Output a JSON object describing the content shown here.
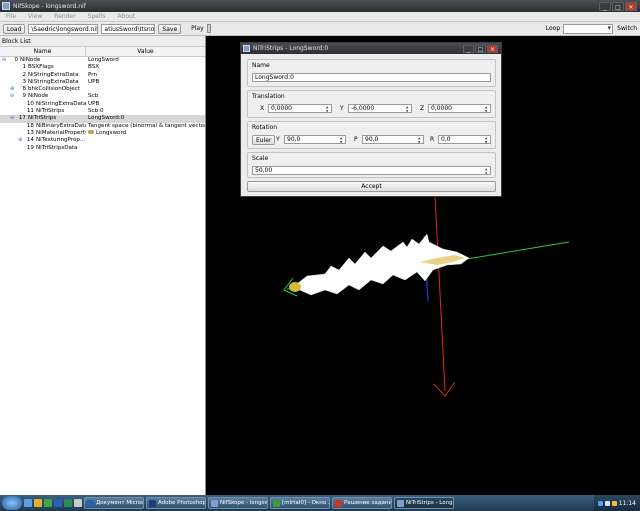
{
  "window": {
    "title": "NifSkope - longsword.nif"
  },
  "menu": [
    "File",
    "View",
    "Render",
    "Spells",
    "About"
  ],
  "toolbar": {
    "load_label": "Load",
    "load_path": "\\Saedric\\longsword.nif",
    "save_path": "atiusSword\\Itsnok.nif",
    "save_label": "Save",
    "play_label": "Play",
    "loop_label": "Loop",
    "switch_label": "Switch"
  },
  "blocklist": {
    "title": "Block List",
    "col_name": "Name",
    "col_value": "Value",
    "rows": [
      {
        "exp": "⊖",
        "num": "0",
        "name": "NiNode",
        "value": "LongSword",
        "indent": 0,
        "selected": false
      },
      {
        "exp": "",
        "num": "1",
        "name": "BSXFlags",
        "value": "BSX",
        "indent": 1,
        "selected": false
      },
      {
        "exp": "",
        "num": "2",
        "name": "NiStringExtraData",
        "value": "Prn",
        "indent": 1,
        "selected": false
      },
      {
        "exp": "",
        "num": "3",
        "name": "NiStringExtraData",
        "value": "UPB",
        "indent": 1,
        "selected": false
      },
      {
        "exp": "⊕",
        "num": "8",
        "name": "bhkCollisionObject",
        "value": "",
        "indent": 1,
        "selected": false
      },
      {
        "exp": "⊖",
        "num": "9",
        "name": "NiNode",
        "value": "Scb",
        "indent": 1,
        "selected": false
      },
      {
        "exp": "",
        "num": "10",
        "name": "NiStringExtraData",
        "value": "UPB",
        "indent": 2,
        "selected": false
      },
      {
        "exp": "",
        "num": "11",
        "name": "NiTriStrips",
        "value": "Scb:0",
        "indent": 2,
        "selected": false
      },
      {
        "exp": "⊖",
        "num": "17",
        "name": "NiTriStrips",
        "value": "LongSword:0",
        "indent": 1,
        "selected": true
      },
      {
        "exp": "",
        "num": "18",
        "name": "NiBinaryExtraData",
        "value": "Tangent space (binormal & tangent vectors)",
        "indent": 2,
        "selected": false
      },
      {
        "exp": "",
        "num": "13",
        "name": "NiMaterialProperty",
        "value": "Longsword",
        "indent": 2,
        "selected": false,
        "icon": true
      },
      {
        "exp": "⊕",
        "num": "14",
        "name": "NiTexturingProp...",
        "value": "",
        "indent": 2,
        "selected": false
      },
      {
        "exp": "",
        "num": "19",
        "name": "NiTriStripsData",
        "value": "",
        "indent": 2,
        "selected": false
      }
    ]
  },
  "dialog": {
    "title": "NiTriStrips - LongSword:0",
    "name_label": "Name",
    "name_value": "LongSword:0",
    "translation_label": "Translation",
    "tx_label": "X",
    "tx": "0,0000",
    "ty_label": "Y",
    "ty": "-6,0000",
    "tz_label": "Z",
    "tz": "0,0000",
    "rotation_label": "Rotation",
    "euler_label": "Euler",
    "ry_label": "Y",
    "ry": "90,0",
    "rp_label": "P",
    "rp": "90,0",
    "rr_label": "R",
    "rr": "0,0",
    "scale_label": "Scale",
    "scale": "50,00",
    "accept_label": "Accept"
  },
  "taskbar": {
    "tasks": [
      {
        "label": "Документ Micros...",
        "color": "#2b5fb5"
      },
      {
        "label": "Adobe Photoshop ...",
        "color": "#1f3c7a"
      },
      {
        "label": "NifSkope - longsw...",
        "color": "#7fa0c8"
      },
      {
        "label": "[mIrtal0] - Окно ...",
        "color": "#3a9b3a"
      },
      {
        "label": "Решение заданий...",
        "color": "#c0392b"
      },
      {
        "label": "NiTriStrips - LongS...",
        "color": "#7fa0c8"
      }
    ],
    "clock": "11:14"
  },
  "colors": {
    "axis_x": "#2ecc40",
    "axis_y": "#e0272b",
    "axis_z": "#2b3ee0",
    "selection_row": "#d7d7d7"
  }
}
